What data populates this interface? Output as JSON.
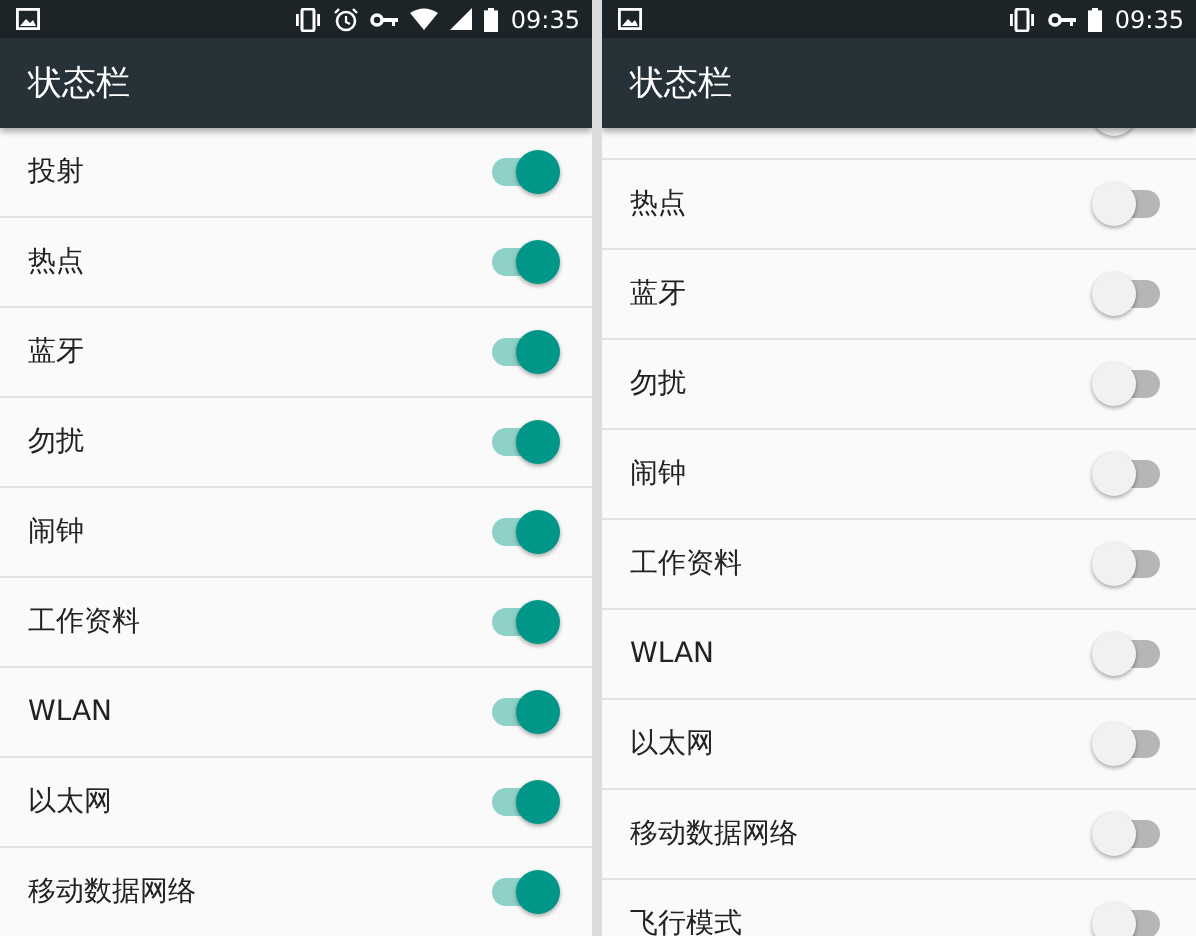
{
  "panels": [
    {
      "status_bar": {
        "icons": [
          {
            "kind": "vibrate"
          },
          {
            "kind": "alarm"
          },
          {
            "kind": "key"
          },
          {
            "kind": "wifi"
          },
          {
            "kind": "signal"
          },
          {
            "kind": "battery"
          }
        ],
        "time": "09:35"
      },
      "title": "状态栏",
      "scrolled": false,
      "items": [
        {
          "label": "投射",
          "on": true
        },
        {
          "label": "热点",
          "on": true
        },
        {
          "label": "蓝牙",
          "on": true
        },
        {
          "label": "勿扰",
          "on": true
        },
        {
          "label": "闹钟",
          "on": true
        },
        {
          "label": "工作资料",
          "on": true
        },
        {
          "label": "WLAN",
          "on": true
        },
        {
          "label": "以太网",
          "on": true
        },
        {
          "label": "移动数据网络",
          "on": true
        }
      ]
    },
    {
      "status_bar": {
        "icons": [
          {
            "kind": "vibrate"
          },
          {
            "kind": "key"
          },
          {
            "kind": "battery"
          }
        ],
        "time": "09:35"
      },
      "title": "状态栏",
      "scrolled": true,
      "items": [
        {
          "on": false
        },
        {
          "label": "热点",
          "on": false
        },
        {
          "label": "蓝牙",
          "on": false
        },
        {
          "label": "勿扰",
          "on": false
        },
        {
          "label": "闹钟",
          "on": false
        },
        {
          "label": "工作资料",
          "on": false
        },
        {
          "label": "WLAN",
          "on": false
        },
        {
          "label": "以太网",
          "on": false
        },
        {
          "label": "移动数据网络",
          "on": false
        },
        {
          "label": "飞行模式",
          "on": false
        }
      ]
    }
  ]
}
